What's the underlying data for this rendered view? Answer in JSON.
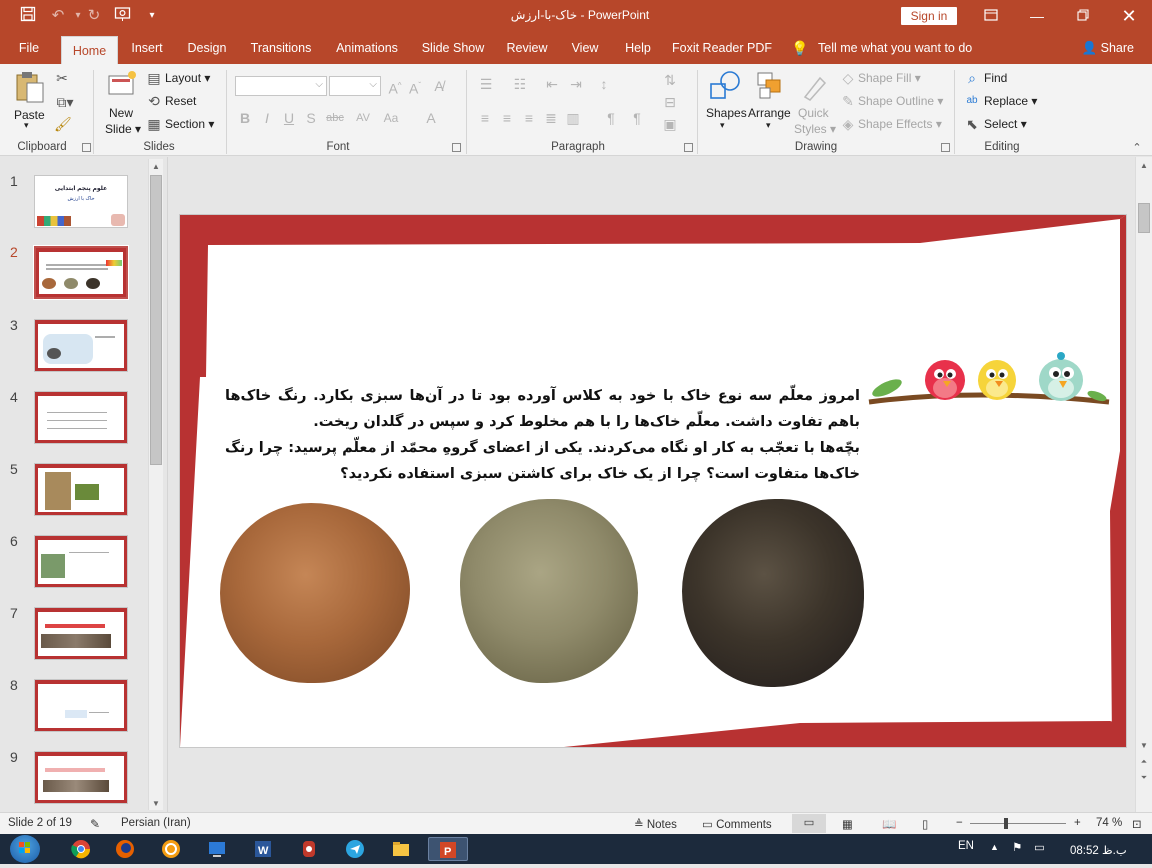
{
  "window": {
    "title": "خاک-با-ارزش  -  PowerPoint",
    "sign_in": "Sign in"
  },
  "qat": {
    "icons": [
      "save-icon",
      "undo-icon",
      "redo-icon",
      "start-from-beginning-icon",
      "customize-qat-icon"
    ]
  },
  "tabs": [
    {
      "label": "File"
    },
    {
      "label": "Home"
    },
    {
      "label": "Insert"
    },
    {
      "label": "Design"
    },
    {
      "label": "Transitions"
    },
    {
      "label": "Animations"
    },
    {
      "label": "Slide Show"
    },
    {
      "label": "Review"
    },
    {
      "label": "View"
    },
    {
      "label": "Help"
    },
    {
      "label": "Foxit Reader PDF"
    }
  ],
  "tell_me": "Tell me what you want to do",
  "share": "Share",
  "ribbon": {
    "clipboard": {
      "label": "Clipboard",
      "paste": "Paste"
    },
    "slides": {
      "label": "Slides",
      "new_slide": "New",
      "new_slide2": "Slide",
      "layout": "Layout",
      "reset": "Reset",
      "section": "Section"
    },
    "font": {
      "label": "Font",
      "bold": "B",
      "italic": "I",
      "underline": "U",
      "shadow": "S",
      "strike": "abc",
      "spacing": "AV",
      "case": "Aa",
      "color": "A"
    },
    "paragraph": {
      "label": "Paragraph"
    },
    "drawing": {
      "label": "Drawing",
      "shapes": "Shapes",
      "arrange": "Arrange",
      "quick_styles": "Quick",
      "quick_styles2": "Styles",
      "shape_fill": "Shape Fill",
      "shape_outline": "Shape Outline",
      "shape_effects": "Shape Effects"
    },
    "editing": {
      "label": "Editing",
      "find": "Find",
      "replace": "Replace",
      "select": "Select"
    }
  },
  "thumbnails": [
    {
      "num": "1",
      "title": "علوم پنجم ابتدایی",
      "subtitle": "خاک با ارزش"
    },
    {
      "num": "2"
    },
    {
      "num": "3"
    },
    {
      "num": "4"
    },
    {
      "num": "5"
    },
    {
      "num": "6"
    },
    {
      "num": "7"
    },
    {
      "num": "8"
    },
    {
      "num": "9"
    }
  ],
  "slide": {
    "paragraph1": "امروز معلّم سه نوع خاک با خود به کلاس آورده بود تا در آن‌ها سبزی بکارد. رنگ خاک‌ها باهم تفاوت داشت. معلّم خاک‌ها را با هم مخلوط کرد و سپس در گلدان ریخت.",
    "paragraph2": "بچّه‌ها با تعجّب به کار او نگاه می‌کردند. یکی از اعضای گروهِ محمّد از معلّم پرسید: چرا رنگ خاک‌ها متفاوت است؟ چرا از یک خاک برای کاشتن سبزی استفاده نکردید؟",
    "soils": [
      {
        "name": "red-brown",
        "color": "#a8683b"
      },
      {
        "name": "grey-green",
        "color": "#8f8a6a"
      },
      {
        "name": "dark",
        "color": "#3c342a"
      }
    ],
    "frame_color": "#b83232"
  },
  "status": {
    "slide_of": "Slide 2 of 19",
    "language": "Persian (Iran)",
    "notes": "Notes",
    "comments": "Comments",
    "zoom": "74 %"
  },
  "taskbar": {
    "lang": "EN",
    "time": "08:52",
    "ampm": "ب.ظ",
    "apps": [
      "chrome",
      "firefox",
      "foxit",
      "remote",
      "word",
      "app6",
      "telegram",
      "explorer",
      "powerpoint"
    ]
  }
}
